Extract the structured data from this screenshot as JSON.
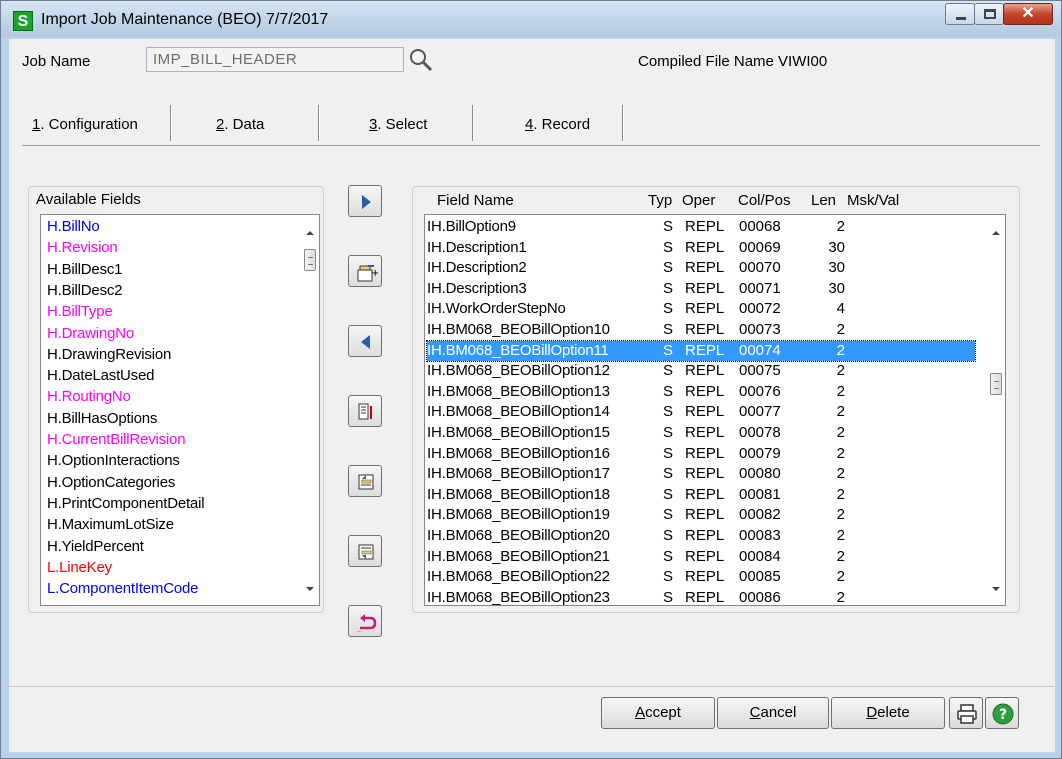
{
  "window": {
    "title": "Import Job Maintenance (BEO) 7/7/2017",
    "app_icon": "S"
  },
  "header": {
    "job_name_label": "Job Name",
    "job_name_value": "IMP_BILL_HEADER",
    "compiled_file": "Compiled File Name  VIWI00"
  },
  "tabs": [
    {
      "key": "1",
      "rest": ". Configuration"
    },
    {
      "key": "2",
      "rest": ". Data"
    },
    {
      "key": "3",
      "rest": ". Select"
    },
    {
      "key": "4",
      "rest": ". Record"
    }
  ],
  "available_fields": {
    "title": "Available Fields",
    "items": [
      {
        "label": "H.BillNo",
        "color": "#0000ff"
      },
      {
        "label": "H.Revision",
        "color": "#ff00ff"
      },
      {
        "label": "H.BillDesc1",
        "color": "#000000"
      },
      {
        "label": "H.BillDesc2",
        "color": "#000000"
      },
      {
        "label": "H.BillType",
        "color": "#ff00ff"
      },
      {
        "label": "H.DrawingNo",
        "color": "#ff00ff"
      },
      {
        "label": "H.DrawingRevision",
        "color": "#000000"
      },
      {
        "label": "H.DateLastUsed",
        "color": "#000000"
      },
      {
        "label": "H.RoutingNo",
        "color": "#ff00ff"
      },
      {
        "label": "H.BillHasOptions",
        "color": "#000000"
      },
      {
        "label": "H.CurrentBillRevision",
        "color": "#ff00ff"
      },
      {
        "label": "H.OptionInteractions",
        "color": "#000000"
      },
      {
        "label": "H.OptionCategories",
        "color": "#000000"
      },
      {
        "label": "H.PrintComponentDetail",
        "color": "#000000"
      },
      {
        "label": "H.MaximumLotSize",
        "color": "#000000"
      },
      {
        "label": "H.YieldPercent",
        "color": "#000000"
      },
      {
        "label": "L.LineKey",
        "color": "#ff0000"
      },
      {
        "label": "L.ComponentItemCode",
        "color": "#0000ff"
      }
    ]
  },
  "fields_table": {
    "headers": {
      "name": "Field Name",
      "typ": "Typ",
      "oper": "Oper",
      "col": "Col/Pos",
      "len": "Len",
      "msk": "Msk/Val"
    },
    "rows": [
      {
        "name": "IH.BillOption9",
        "typ": "S",
        "oper": "REPL",
        "col": "00068",
        "len": "2"
      },
      {
        "name": "IH.Description1",
        "typ": "S",
        "oper": "REPL",
        "col": "00069",
        "len": "30"
      },
      {
        "name": "IH.Description2",
        "typ": "S",
        "oper": "REPL",
        "col": "00070",
        "len": "30"
      },
      {
        "name": "IH.Description3",
        "typ": "S",
        "oper": "REPL",
        "col": "00071",
        "len": "30"
      },
      {
        "name": "IH.WorkOrderStepNo",
        "typ": "S",
        "oper": "REPL",
        "col": "00072",
        "len": "4"
      },
      {
        "name": "IH.BM068_BEOBillOption10",
        "typ": "S",
        "oper": "REPL",
        "col": "00073",
        "len": "2"
      },
      {
        "name": "IH.BM068_BEOBillOption11",
        "typ": "S",
        "oper": "REPL",
        "col": "00074",
        "len": "2",
        "selected": true
      },
      {
        "name": "IH.BM068_BEOBillOption12",
        "typ": "S",
        "oper": "REPL",
        "col": "00075",
        "len": "2"
      },
      {
        "name": "IH.BM068_BEOBillOption13",
        "typ": "S",
        "oper": "REPL",
        "col": "00076",
        "len": "2"
      },
      {
        "name": "IH.BM068_BEOBillOption14",
        "typ": "S",
        "oper": "REPL",
        "col": "00077",
        "len": "2"
      },
      {
        "name": "IH.BM068_BEOBillOption15",
        "typ": "S",
        "oper": "REPL",
        "col": "00078",
        "len": "2"
      },
      {
        "name": "IH.BM068_BEOBillOption16",
        "typ": "S",
        "oper": "REPL",
        "col": "00079",
        "len": "2"
      },
      {
        "name": "IH.BM068_BEOBillOption17",
        "typ": "S",
        "oper": "REPL",
        "col": "00080",
        "len": "2"
      },
      {
        "name": "IH.BM068_BEOBillOption18",
        "typ": "S",
        "oper": "REPL",
        "col": "00081",
        "len": "2"
      },
      {
        "name": "IH.BM068_BEOBillOption19",
        "typ": "S",
        "oper": "REPL",
        "col": "00082",
        "len": "2"
      },
      {
        "name": "IH.BM068_BEOBillOption20",
        "typ": "S",
        "oper": "REPL",
        "col": "00083",
        "len": "2"
      },
      {
        "name": "IH.BM068_BEOBillOption21",
        "typ": "S",
        "oper": "REPL",
        "col": "00084",
        "len": "2"
      },
      {
        "name": "IH.BM068_BEOBillOption22",
        "typ": "S",
        "oper": "REPL",
        "col": "00085",
        "len": "2"
      },
      {
        "name": "IH.BM068_BEOBillOption23",
        "typ": "S",
        "oper": "REPL",
        "col": "00086",
        "len": "2"
      }
    ]
  },
  "side_buttons": [
    "add-field-icon",
    "insert-field-icon",
    "remove-field-icon",
    "properties-icon",
    "move-up-icon",
    "move-down-icon",
    "undo-icon"
  ],
  "footer": {
    "accept_key": "A",
    "accept_rest": "ccept",
    "cancel_key": "C",
    "cancel_rest": "ancel",
    "delete_key": "D",
    "delete_rest": "elete"
  }
}
